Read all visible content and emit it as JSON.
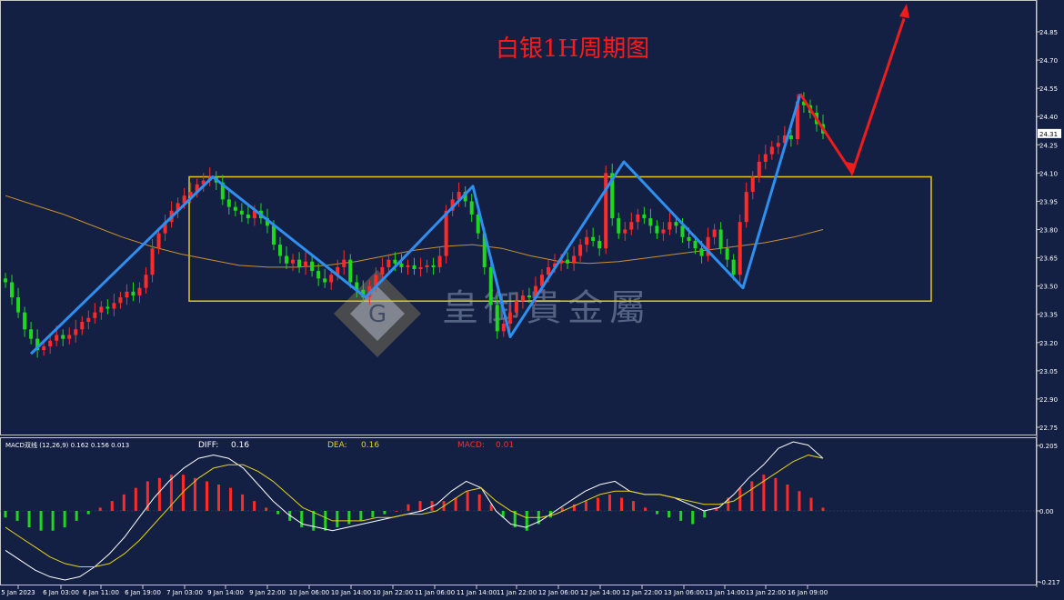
{
  "watermark": "皇御貴金屬",
  "colors": {
    "background": "#132043",
    "bull_candle": "#ff2a2a",
    "bear_candle": "#1ed81e",
    "zigzag": "#2e8ff0",
    "forecast": "#ee1c1c",
    "range_box": "#e6c619",
    "moving_average": "#c8912b",
    "diff_line": "#ffffff",
    "dea_line": "#e6d219"
  },
  "chart_data": [
    {
      "type": "candlestick",
      "title": "白银1H周期图",
      "y_ticks": [
        "24.85",
        "24.70",
        "24.55",
        "24.40",
        "24.25",
        "24.10",
        "23.95",
        "23.80",
        "23.65",
        "23.50",
        "23.35",
        "23.20",
        "23.05",
        "22.90",
        "22.75"
      ],
      "ylim": [
        22.75,
        24.95
      ],
      "last_price": 24.31,
      "last_price_label": "24.31",
      "x_ticks": [
        "5 Jan 2023",
        "6 Jan 03:00",
        "6 Jan 11:00",
        "6 Jan 19:00",
        "7 Jan 03:00",
        "9 Jan 14:00",
        "9 Jan 22:00",
        "10 Jan 06:00",
        "10 Jan 14:00",
        "10 Jan 22:00",
        "11 Jan 06:00",
        "11 Jan 14:00",
        "11 Jan 22:00",
        "12 Jan 06:00",
        "12 Jan 14:00",
        "12 Jan 22:00",
        "13 Jan 06:00",
        "13 Jan 14:00",
        "13 Jan 22:00",
        "16 Jan 09:00"
      ],
      "range_box": {
        "top": 24.08,
        "bottom": 23.42,
        "x_start_label": "7 Jan 03:00",
        "x_end_label": "13 Jan 22:00"
      },
      "close_series": [
        23.52,
        23.44,
        23.36,
        23.27,
        23.22,
        23.16,
        23.18,
        23.21,
        23.24,
        23.22,
        23.24,
        23.27,
        23.31,
        23.33,
        23.36,
        23.39,
        23.38,
        23.41,
        23.44,
        23.47,
        23.45,
        23.49,
        23.56,
        23.7,
        23.78,
        23.84,
        23.9,
        23.94,
        23.98,
        24.0,
        24.04,
        24.06,
        24.08,
        24.05,
        23.96,
        23.92,
        23.9,
        23.88,
        23.86,
        23.9,
        23.86,
        23.82,
        23.72,
        23.66,
        23.62,
        23.64,
        23.6,
        23.63,
        23.58,
        23.54,
        23.52,
        23.56,
        23.6,
        23.64,
        23.52,
        23.48,
        23.44,
        23.5,
        23.56,
        23.6,
        23.64,
        23.62,
        23.6,
        23.61,
        23.59,
        23.6,
        23.61,
        23.6,
        23.66,
        23.9,
        23.96,
        24.0,
        23.95,
        23.88,
        23.78,
        23.6,
        23.4,
        23.26,
        23.3,
        23.36,
        23.42,
        23.45,
        23.44,
        23.5,
        23.56,
        23.6,
        23.62,
        23.64,
        23.62,
        23.66,
        23.72,
        23.76,
        23.74,
        23.7,
        24.1,
        23.86,
        23.78,
        23.8,
        23.84,
        23.88,
        23.86,
        23.82,
        23.78,
        23.8,
        23.84,
        23.82,
        23.76,
        23.74,
        23.7,
        23.66,
        23.76,
        23.8,
        23.7,
        23.64,
        23.56,
        23.84,
        24.0,
        24.08,
        24.16,
        24.2,
        24.24,
        24.26,
        24.3,
        24.28,
        24.48,
        24.46,
        24.42,
        24.36,
        24.31
      ],
      "moving_average": [
        23.98,
        23.93,
        23.88,
        23.82,
        23.76,
        23.71,
        23.67,
        23.64,
        23.61,
        23.6,
        23.6,
        23.61,
        23.63,
        23.66,
        23.69,
        23.71,
        23.72,
        23.7,
        23.66,
        23.63,
        23.62,
        23.63,
        23.65,
        23.67,
        23.69,
        23.71,
        23.73,
        23.76,
        23.8
      ],
      "zigzag": [
        {
          "x": "6 Jan 03:00",
          "y": 23.14
        },
        {
          "x": "9 Jan 14:00",
          "y": 24.08
        },
        {
          "x": "10 Jan 14:00",
          "y": 23.44
        },
        {
          "x": "11 Jan 14:00",
          "y": 24.03
        },
        {
          "x": "11 Jan 22:00",
          "y": 23.23
        },
        {
          "x": "12 Jan 14:00",
          "y": 24.16
        },
        {
          "x": "13 Jan 14:00",
          "y": 23.49
        },
        {
          "x": "16 Jan 09:00",
          "y": 24.52
        }
      ],
      "forecast": [
        {
          "x": "16 Jan 09:00",
          "y": 24.52
        },
        {
          "x": "after 16 Jan 09:00",
          "y": 24.1
        },
        {
          "x": "after 16 Jan 09:00",
          "y": 24.92
        }
      ]
    },
    {
      "type": "macd",
      "header": "MACD双线 (12,26,9) 0.162 0.156 0.013",
      "labels": {
        "diff": "DIFF:",
        "diff_value": "0.16",
        "dea": "DEA:",
        "dea_value": "0.16",
        "macd": "MACD:",
        "macd_value": "0.01"
      },
      "y_ticks": [
        "0.205",
        "0.00",
        "-0.217"
      ],
      "ylim": [
        -0.217,
        0.205
      ],
      "histogram": [
        -0.02,
        -0.03,
        -0.05,
        -0.06,
        -0.06,
        -0.05,
        -0.03,
        -0.01,
        0.01,
        0.03,
        0.05,
        0.07,
        0.09,
        0.1,
        0.11,
        0.11,
        0.1,
        0.09,
        0.08,
        0.07,
        0.05,
        0.03,
        0.01,
        -0.01,
        -0.03,
        -0.05,
        -0.06,
        -0.06,
        -0.05,
        -0.04,
        -0.03,
        -0.02,
        -0.01,
        0.0,
        0.02,
        0.03,
        0.03,
        0.03,
        0.04,
        0.06,
        0.05,
        0.02,
        -0.02,
        -0.05,
        -0.06,
        -0.04,
        -0.02,
        0.01,
        0.02,
        0.03,
        0.04,
        0.05,
        0.04,
        0.03,
        0.01,
        -0.01,
        -0.02,
        -0.03,
        -0.04,
        -0.02,
        0.01,
        0.04,
        0.07,
        0.09,
        0.11,
        0.1,
        0.08,
        0.06,
        0.04,
        0.01
      ],
      "diff": [
        -0.12,
        -0.15,
        -0.18,
        -0.2,
        -0.21,
        -0.2,
        -0.17,
        -0.13,
        -0.08,
        -0.02,
        0.04,
        0.09,
        0.13,
        0.16,
        0.17,
        0.16,
        0.13,
        0.08,
        0.03,
        -0.01,
        -0.04,
        -0.05,
        -0.06,
        -0.05,
        -0.04,
        -0.03,
        -0.02,
        -0.01,
        0.0,
        0.02,
        0.06,
        0.09,
        0.07,
        0.0,
        -0.04,
        -0.05,
        -0.03,
        0.0,
        0.03,
        0.06,
        0.08,
        0.09,
        0.06,
        0.05,
        0.05,
        0.04,
        0.02,
        0.0,
        0.01,
        0.05,
        0.1,
        0.14,
        0.19,
        0.21,
        0.2,
        0.16
      ],
      "dea": [
        -0.05,
        -0.08,
        -0.11,
        -0.14,
        -0.16,
        -0.17,
        -0.17,
        -0.16,
        -0.13,
        -0.09,
        -0.04,
        0.01,
        0.06,
        0.1,
        0.13,
        0.14,
        0.14,
        0.12,
        0.09,
        0.05,
        0.01,
        -0.01,
        -0.03,
        -0.03,
        -0.03,
        -0.02,
        -0.02,
        -0.01,
        -0.01,
        0.0,
        0.03,
        0.06,
        0.07,
        0.03,
        0.0,
        -0.02,
        -0.02,
        -0.01,
        0.01,
        0.03,
        0.05,
        0.06,
        0.06,
        0.05,
        0.05,
        0.04,
        0.03,
        0.02,
        0.02,
        0.03,
        0.06,
        0.09,
        0.12,
        0.15,
        0.17,
        0.16
      ]
    }
  ]
}
